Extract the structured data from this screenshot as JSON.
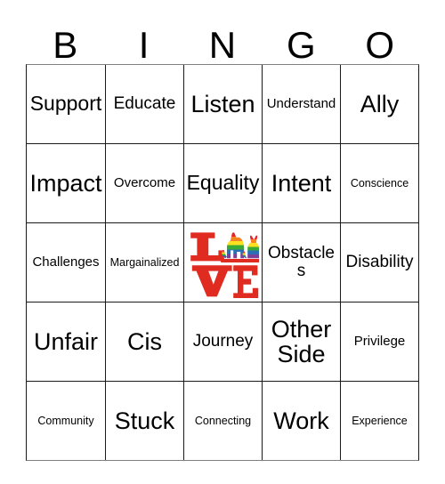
{
  "card": {
    "header_letters": [
      "B",
      "I",
      "N",
      "G",
      "O"
    ],
    "rows": [
      [
        {
          "text": "Support",
          "size": "lg"
        },
        {
          "text": "Educate",
          "size": "md"
        },
        {
          "text": "Listen",
          "size": "xl"
        },
        {
          "text": "Understand",
          "size": "sm"
        },
        {
          "text": "Ally",
          "size": "xl"
        }
      ],
      [
        {
          "text": "Impact",
          "size": "xl"
        },
        {
          "text": "Overcome",
          "size": "sm"
        },
        {
          "text": "Equality",
          "size": "lg"
        },
        {
          "text": "Intent",
          "size": "xl"
        },
        {
          "text": "Conscience",
          "size": "xs"
        }
      ],
      [
        {
          "text": "Challenges",
          "size": "sm"
        },
        {
          "text": "Margainalized",
          "size": "xs"
        },
        {
          "text": "LOVE",
          "size": "free",
          "free_space": true
        },
        {
          "text": "Obstacles",
          "size": "md"
        },
        {
          "text": "Disability",
          "size": "md"
        }
      ],
      [
        {
          "text": "Unfair",
          "size": "xl"
        },
        {
          "text": "Cis",
          "size": "xl"
        },
        {
          "text": "Journey",
          "size": "md"
        },
        {
          "text": "Other Side",
          "size": "xl"
        },
        {
          "text": "Privilege",
          "size": "sm"
        }
      ],
      [
        {
          "text": "Community",
          "size": "xs"
        },
        {
          "text": "Stuck",
          "size": "xl"
        },
        {
          "text": "Connecting",
          "size": "xs"
        },
        {
          "text": "Work",
          "size": "xl"
        },
        {
          "text": "Experience",
          "size": "xs"
        }
      ]
    ],
    "free_space": {
      "icon": "rainbow-love-dog-cat-icon",
      "letters": [
        "L",
        "V",
        "E"
      ],
      "letter_color": "#E02B20",
      "rainbow_colors": [
        "#E8232A",
        "#F58220",
        "#FBE122",
        "#3BAA35",
        "#2B6FB5",
        "#7E3F98"
      ],
      "animals": [
        "dog-silhouette",
        "cat-silhouette"
      ]
    }
  }
}
